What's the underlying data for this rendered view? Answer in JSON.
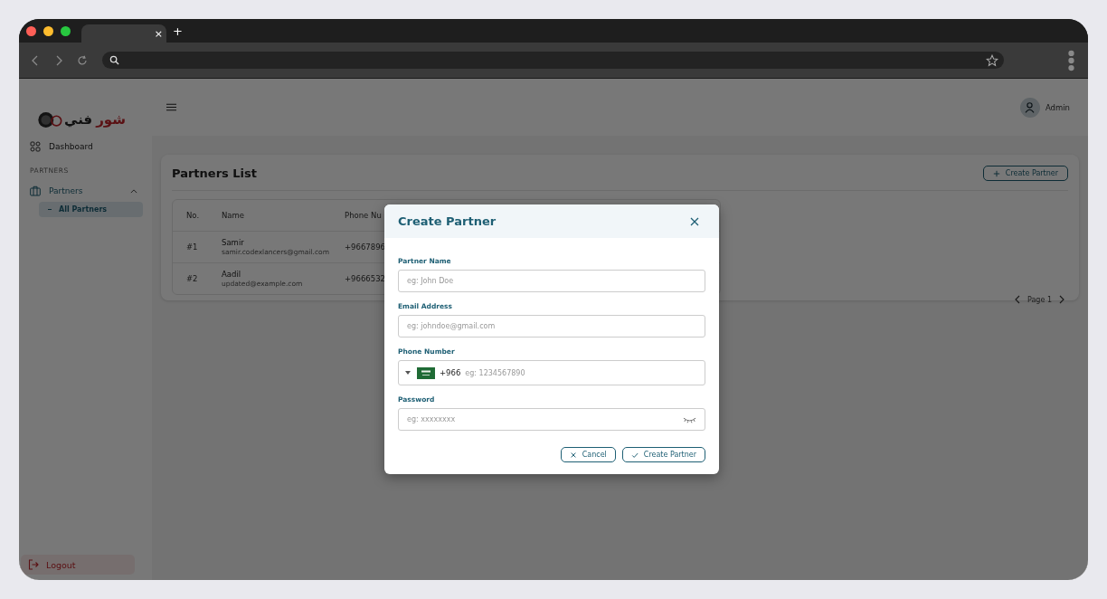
{
  "browser": {
    "tab_close": "×",
    "new_tab": "+"
  },
  "sidebar": {
    "logo": {
      "red_word": "شور",
      "dark_word": "فني"
    },
    "items": [
      {
        "label": "Dashboard",
        "selected": false
      }
    ],
    "section": "PARTNERS",
    "group": {
      "label": "Partners",
      "expanded": true,
      "children": [
        {
          "label": "All Partners",
          "selected": true
        }
      ]
    },
    "logout": "Logout"
  },
  "header": {
    "user": "Admin"
  },
  "page": {
    "title": "Partners List",
    "create_button": "Create Partner",
    "table": {
      "columns": [
        "No.",
        "Name",
        "Phone Nu"
      ],
      "rows": [
        {
          "no": "#1",
          "name": "Samir",
          "email": "samir.codexlancers@gmail.com",
          "phone": "+9667896"
        },
        {
          "no": "#2",
          "name": "Aadil",
          "email": "updated@example.com",
          "phone": "+9666532"
        }
      ]
    },
    "pagination": "Page 1"
  },
  "modal": {
    "title": "Create Partner",
    "fields": [
      {
        "kind": "text",
        "label": "Partner Name",
        "placeholder": "eg: John Doe"
      },
      {
        "kind": "text",
        "label": "Email Address",
        "placeholder": "eg: johndoe@gmail.com"
      },
      {
        "kind": "phone",
        "label": "Phone Number",
        "dial_code": "+966",
        "placeholder": "eg: 1234567890"
      },
      {
        "kind": "password",
        "label": "Password",
        "placeholder": "eg: xxxxxxxx"
      }
    ],
    "buttons": [
      {
        "kind": "cancel",
        "label": "Cancel"
      },
      {
        "kind": "confirm",
        "label": "Create Partner"
      }
    ]
  }
}
